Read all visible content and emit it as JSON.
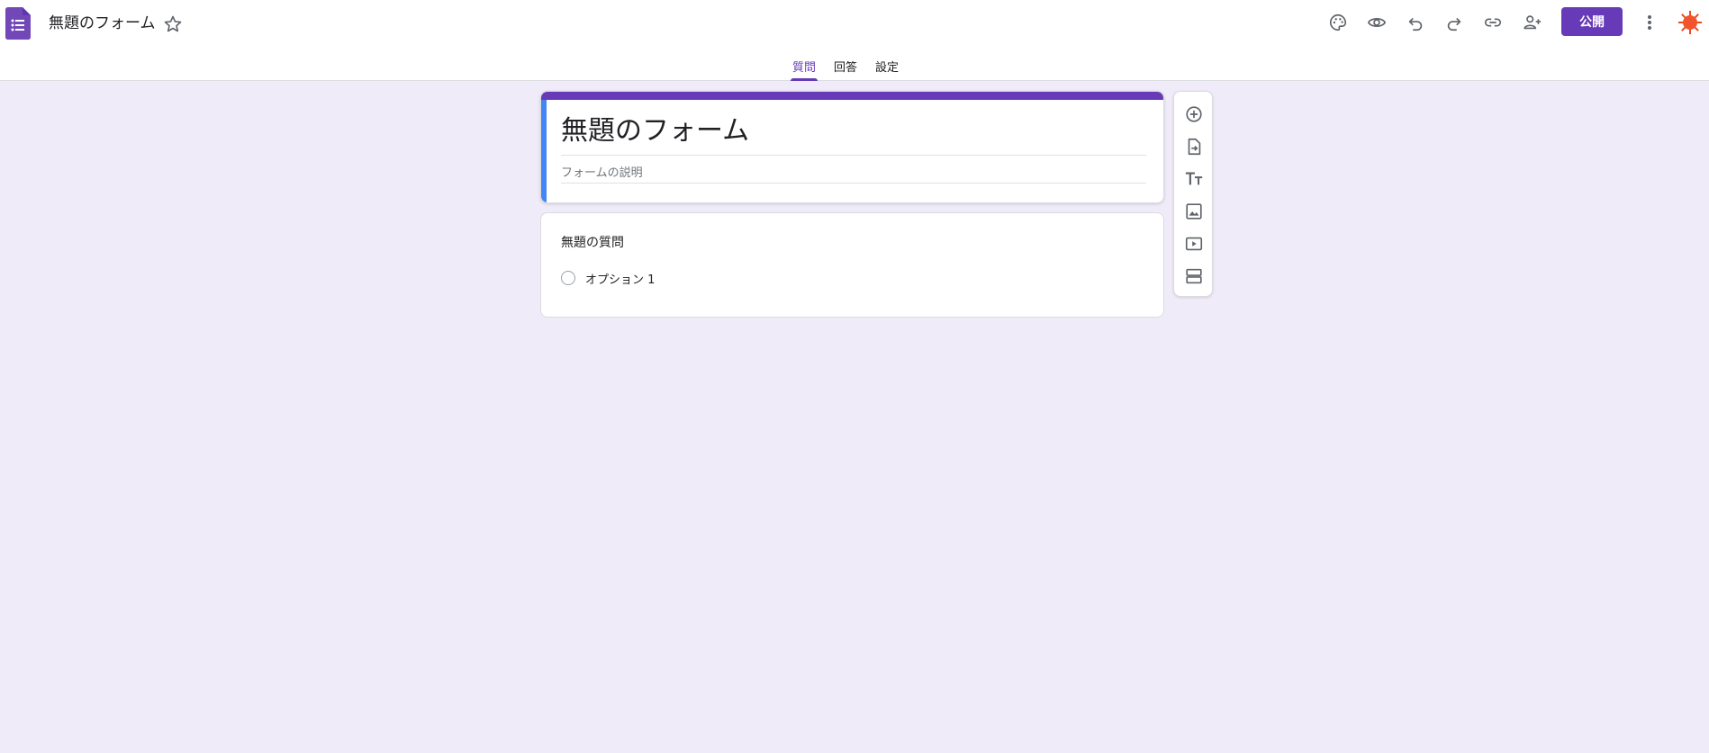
{
  "header": {
    "title": "無題のフォーム",
    "publish_label": "公開",
    "tools": [
      "palette-icon",
      "preview-eye-icon",
      "undo-icon",
      "redo-icon",
      "link-icon",
      "add-collaborator-icon"
    ]
  },
  "tabs": [
    {
      "label": "質問",
      "active": true
    },
    {
      "label": "回答",
      "active": false
    },
    {
      "label": "設定",
      "active": false
    }
  ],
  "form": {
    "title": "無題のフォーム",
    "description_placeholder": "フォームの説明"
  },
  "question": {
    "title": "無題の質問",
    "options": [
      "オプション 1"
    ]
  },
  "side_toolbar": [
    "add-question-icon",
    "import-questions-icon",
    "add-title-icon",
    "add-image-icon",
    "add-video-icon",
    "add-section-icon"
  ],
  "colors": {
    "accent": "#673ab7",
    "background": "#f0ebf8",
    "title_card_left": "#4285f4"
  }
}
